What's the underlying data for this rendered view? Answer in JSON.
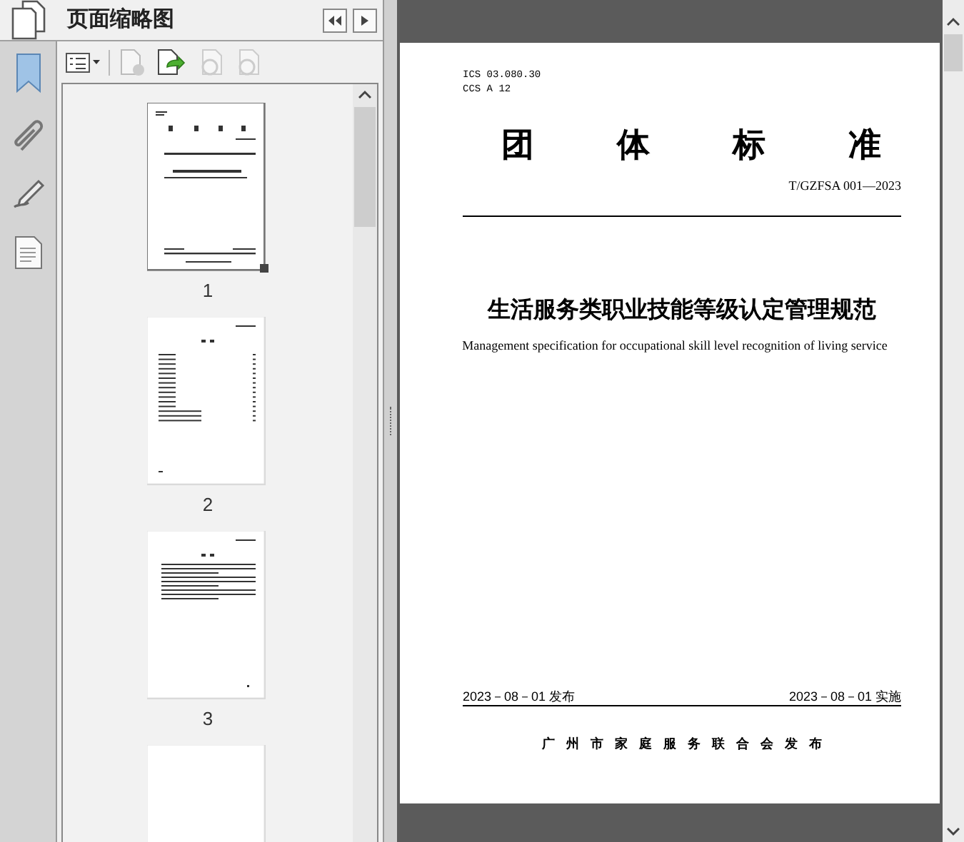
{
  "panel": {
    "title": "页面缩略图"
  },
  "thumbnails": [
    {
      "kind": "cover",
      "page_number": "1",
      "selected": true
    },
    {
      "kind": "contents",
      "page_number": "2",
      "selected": false
    },
    {
      "kind": "foreword",
      "page_number": "3",
      "selected": false
    },
    {
      "kind": "blank",
      "selected": false
    }
  ],
  "page": {
    "ics": "ICS 03.080.30",
    "ccs": "CCS A 12",
    "heading": "团体标准",
    "code": "T/GZFSA 001—2023",
    "title": "生活服务类职业技能等级认定管理规范",
    "subtitle": "Management specification for occupational skill level recognition of living service",
    "publish_date": "2023－08－01 发布",
    "implement_date": "2023－08－01 实施",
    "publisher": "广州市家庭服务联合会发布"
  }
}
